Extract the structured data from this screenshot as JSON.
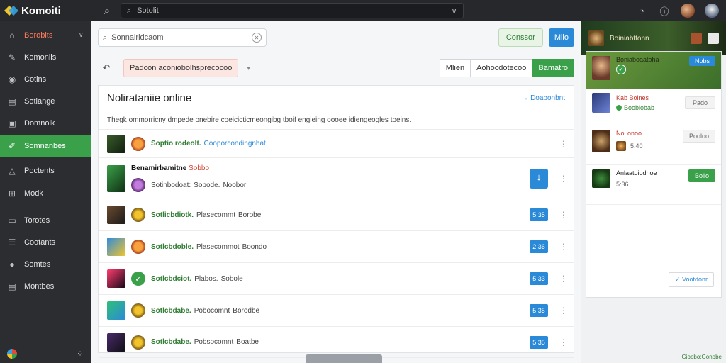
{
  "app": {
    "name": "Komoiti",
    "search_placeholder": "Sotolit"
  },
  "sidebar": {
    "items": [
      {
        "label": "Borobits",
        "icon": "home-icon",
        "glyph": "⌂"
      },
      {
        "label": "Komonils",
        "icon": "pencil-icon",
        "glyph": "✎"
      },
      {
        "label": "Cotins",
        "icon": "circle-icon",
        "glyph": "◉"
      },
      {
        "label": "Sotlange",
        "icon": "layers-icon",
        "glyph": "▤"
      },
      {
        "label": "Domnolk",
        "icon": "book-icon",
        "glyph": "▣"
      },
      {
        "label": "Somnanbes",
        "icon": "pen-icon",
        "glyph": "✐"
      },
      {
        "label": "Poctents",
        "icon": "triangle-icon",
        "glyph": "△"
      },
      {
        "label": "Modk",
        "icon": "grid-icon",
        "glyph": "⊞"
      },
      {
        "label": "Torotes",
        "icon": "folder-icon",
        "glyph": "▭"
      },
      {
        "label": "Cootants",
        "icon": "list-icon",
        "glyph": "☰"
      },
      {
        "label": "Somtes",
        "icon": "person-icon",
        "glyph": "●"
      },
      {
        "label": "Montbes",
        "icon": "document-icon",
        "glyph": "▤"
      }
    ]
  },
  "toolbar": {
    "search_value": "Sonnairidcaom",
    "connect_label": "Conssor",
    "blue_label": "Mlio"
  },
  "filter": {
    "chip_label": "Padcon aconiobolhsprecocoo",
    "seg_1": "Mlien",
    "seg_2": "Aohocdotecoo",
    "seg_3": "Bamatro"
  },
  "panel": {
    "title": "Nolirataniie online",
    "link": "Doabonbnt",
    "description": "Thegk ommorricny dmpede onebire coeicicticmeongibg tboif engieing oooee idiengeogles toeins."
  },
  "rows": [
    {
      "b1": "Soptio rodeolt.",
      "b2": "Cooporcondingnhat",
      "pill": "",
      "badge": "b-orange"
    },
    {
      "title": "Benamirbamitne",
      "title_red": "Sobbo",
      "b1": "Sotinbodoat:",
      "b2": "Sobode.",
      "b3": "Noobor",
      "pill": "",
      "badge": "b-purple"
    },
    {
      "b1": "Sotlicbdiotk.",
      "b2": "Plasecommt",
      "b3": "Borobe",
      "pill": "5:35",
      "badge": "b-gold"
    },
    {
      "b1": "Sotlcbdoble.",
      "b2": "Plasecommot",
      "b3": "Boondo",
      "pill": "2:36",
      "badge": "b-orange"
    },
    {
      "b1": "Sotlcbdciot.",
      "b2": "Plabos.",
      "b3": "Sobole",
      "pill": "5:33",
      "badge": "b-check"
    },
    {
      "b1": "Sotlcbdabe.",
      "b2": "Pobocomnt",
      "b3": "Borodbe",
      "pill": "5:35",
      "badge": "b-gold"
    },
    {
      "b1": "Sotlcbdabe.",
      "b2": "Pobsocomnt",
      "b3": "Boatbe",
      "pill": "5:35",
      "badge": "b-gold"
    }
  ],
  "rightbar": {
    "hero_text": "Boiniabttonn",
    "card_title": "Boniaboaatoha",
    "card_btn": "Nobs",
    "item1_title": "Kab Bolnes",
    "item1_status": "Boobiobab",
    "item1_btn": "Pado",
    "item2_title": "Nol onoo",
    "item2_sub": "5:40",
    "item2_btn": "Pooloo",
    "item3_title": "Anlaatoiodnoe",
    "item3_sub": "5:36",
    "item3_btn": "Bolio",
    "footer_btn": "Vootdonr",
    "credit": "Gioobo:Gonobe"
  },
  "colors": {
    "accent_green": "#3aa04a",
    "accent_blue": "#2b8ad8",
    "sidebar_bg": "#2b2d31"
  }
}
